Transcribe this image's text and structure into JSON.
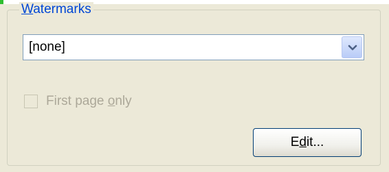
{
  "watermarks": {
    "title_pre": "",
    "title_mnemonic": "W",
    "title_post": "atermarks",
    "selected_value": "[none]",
    "checkbox": {
      "label_pre": "First page ",
      "label_mnemonic": "o",
      "label_post": "nly",
      "checked": false,
      "enabled": false
    },
    "edit_button": {
      "label_pre": "E",
      "label_mnemonic": "d",
      "label_post": "it..."
    }
  },
  "colors": {
    "legend_text": "#0046d5",
    "panel_background": "#ece9d8",
    "disabled_text": "#aca899",
    "accent_green": "#2fbe2f"
  }
}
